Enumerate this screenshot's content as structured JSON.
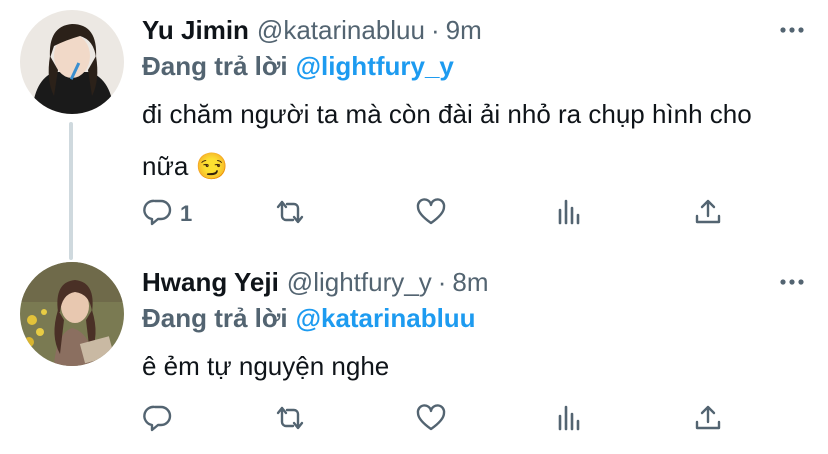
{
  "tweets": [
    {
      "display_name": "Yu Jimin",
      "handle": "@katarinabluu",
      "dot": "·",
      "time": "9m",
      "reply_prefix": "Đang trả lời",
      "reply_mention": "@lightfury_y",
      "text": "đi chăm người ta mà còn đài ải nhỏ ra chụp hình cho nữa 😏",
      "reply_count": "1",
      "icons": [
        "reply-icon",
        "retweet-icon",
        "like-icon",
        "analytics-icon",
        "share-icon"
      ]
    },
    {
      "display_name": "Hwang Yeji",
      "handle": "@lightfury_y",
      "dot": "·",
      "time": "8m",
      "reply_prefix": "Đang trả lời",
      "reply_mention": "@katarinabluu",
      "text": "ê ẻm tự nguyện nghe",
      "reply_count": "",
      "icons": [
        "reply-icon",
        "retweet-icon",
        "like-icon",
        "analytics-icon",
        "share-icon"
      ]
    }
  ],
  "colors": {
    "mention": "#1d9bf0",
    "secondary_text": "#536471",
    "icon": "#536471",
    "thread_line": "#cfd9de"
  }
}
